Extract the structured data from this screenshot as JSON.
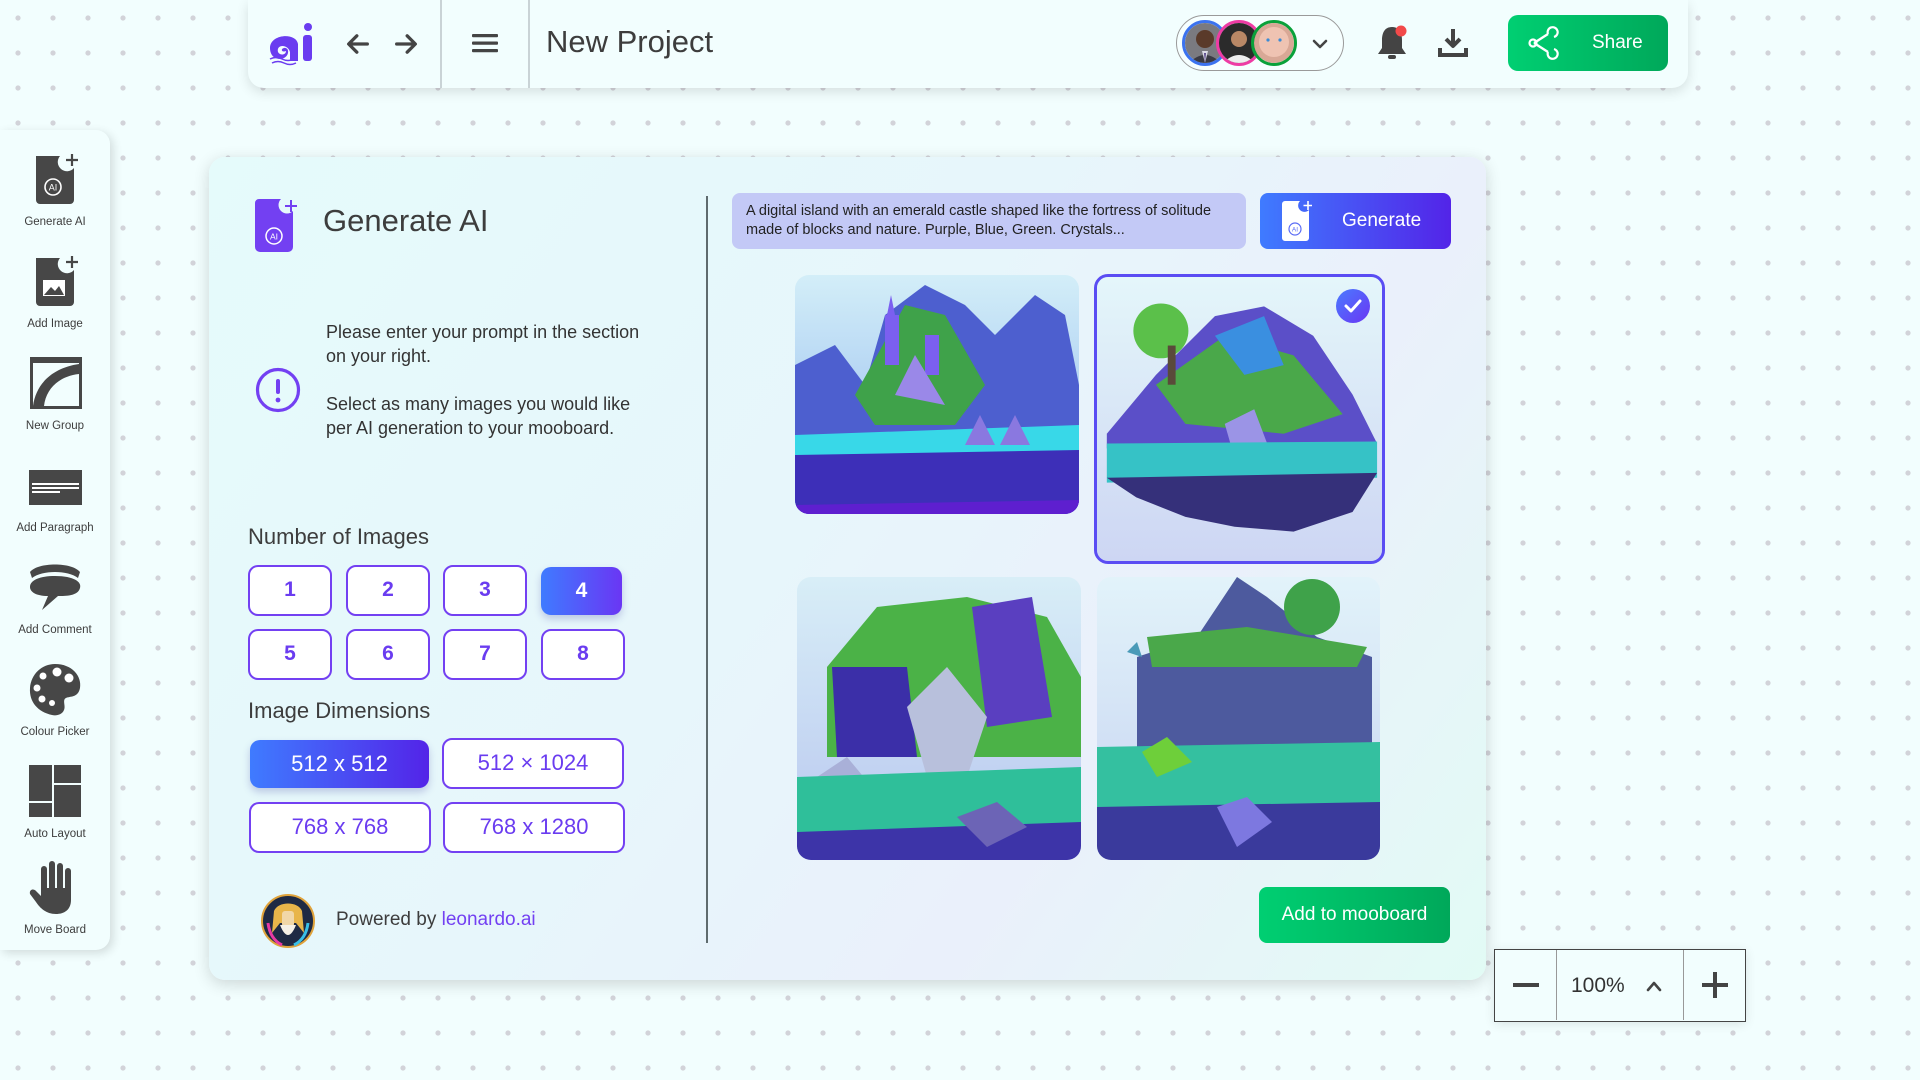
{
  "topbar": {
    "project_title": "New Project",
    "collaborators": [
      {
        "name": "collaborator-1",
        "ring_color": "#3b73f0"
      },
      {
        "name": "collaborator-2",
        "ring_color": "#ee3ca4"
      },
      {
        "name": "collaborator-3",
        "ring_color": "#0aa13a"
      }
    ],
    "notification_dot": true,
    "share_label": "Share"
  },
  "sidebar": {
    "items": [
      {
        "label": "Generate AI",
        "icon": "generate-ai-icon"
      },
      {
        "label": "Add Image",
        "icon": "add-image-icon"
      },
      {
        "label": "New Group",
        "icon": "new-group-icon"
      },
      {
        "label": "Add Paragraph",
        "icon": "paragraph-icon"
      },
      {
        "label": "Add Comment",
        "icon": "comment-icon"
      },
      {
        "label": "Colour Picker",
        "icon": "palette-icon"
      },
      {
        "label": "Auto Layout",
        "icon": "layout-icon"
      },
      {
        "label": "Move Board",
        "icon": "hand-icon"
      }
    ]
  },
  "panel": {
    "title": "Generate AI",
    "info_line1": "Please enter your prompt in the section on your right.",
    "info_line2": "Select as many images you would like per AI generation to your mooboard.",
    "num_images_label": "Number of Images",
    "num_images_options": [
      "1",
      "2",
      "3",
      "4",
      "5",
      "6",
      "7",
      "8"
    ],
    "num_images_selected": "4",
    "dimensions_label": "Image Dimensions",
    "dimension_options": [
      "512 x 512",
      "512 × 1024",
      "768 x 768",
      "768 x 1280"
    ],
    "dimension_selected": "512 x 512",
    "powered_by": "Powered by",
    "powered_link": "leonardo.ai",
    "prompt": "A digital island with an emerald castle shaped like the fortress of solitude made of blocks and nature. Purple, Blue, Green. Crystals...",
    "generate_label": "Generate",
    "images": [
      {
        "description": "floating island with purple crystal castle towers",
        "selected": false
      },
      {
        "description": "floating island with purple rocks and tree",
        "selected": true
      },
      {
        "description": "island cliffs with grey boulders and greenery",
        "selected": false
      },
      {
        "description": "floating island with rocky cliffs and trees",
        "selected": false
      }
    ],
    "add_label": "Add to mooboard",
    "accent_purple": "#7340f2",
    "accent_green": "#00c06a"
  },
  "zoom": {
    "value": "100%"
  }
}
